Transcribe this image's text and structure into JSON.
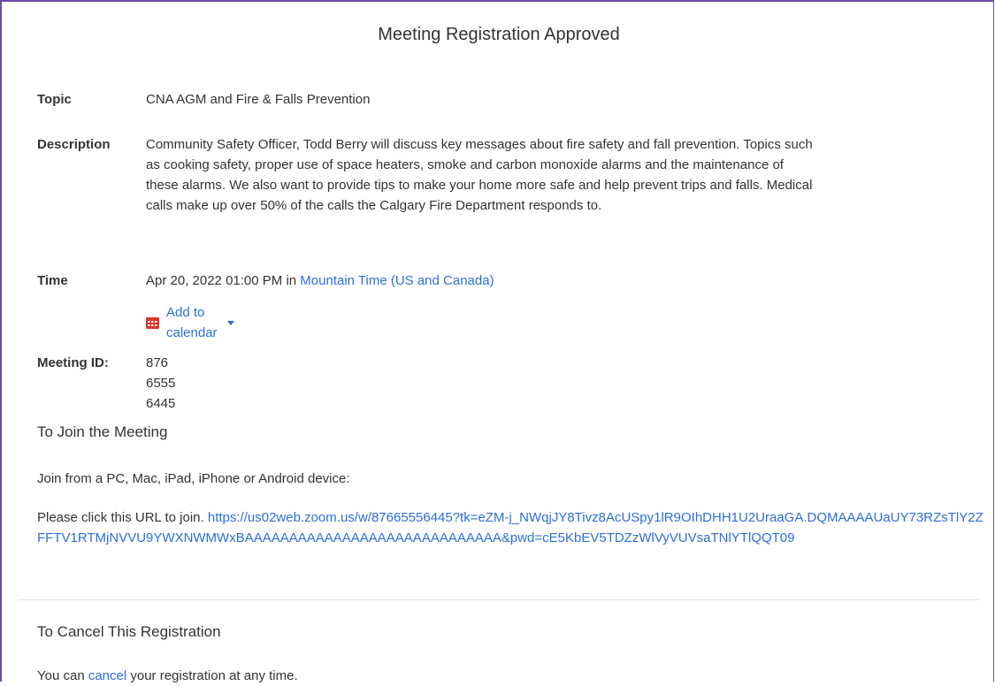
{
  "page_title": "Meeting Registration Approved",
  "topic": {
    "label": "Topic",
    "value": "CNA AGM and Fire & Falls Prevention"
  },
  "description": {
    "label": "Description",
    "value": "Community Safety Officer, Todd Berry will discuss key messages about fire safety and fall prevention. Topics such as cooking safety, proper use of space heaters, smoke and carbon monoxide alarms and the maintenance of these alarms.  We also want to provide tips to make your home more safe and help prevent trips and falls. Medical calls make up over 50% of the calls the Calgary Fire Department responds to."
  },
  "time": {
    "label": "Time",
    "date_text": "Apr 20, 2022 01:00 PM in",
    "timezone_link": "Mountain Time (US and Canada)",
    "add_calendar": "Add to calendar",
    "calendar_icon": "calendar-icon",
    "calendar_icon_color": "#d9342b"
  },
  "meeting_id": {
    "label": "Meeting ID:",
    "value": "876 6555 6445"
  },
  "join": {
    "heading": "To Join the Meeting",
    "devices_text": "Join from a PC, Mac, iPad, iPhone or Android device:",
    "click_text": "Please click this URL to join.",
    "url": "https://us02web.zoom.us/w/87665556445?tk=eZM-j_NWqjJY8Tivz8AcUSpy1lR9OIhDHH1U2UraaGA.DQMAAAAUaUY73RZsTlY2ZFFTV1RTMjNVVU9YWXNWMWxBAAAAAAAAAAAAAAAAAAAAAAAAAAAAA&pwd=cE5KbEV5TDZzWlVyVUVsaTNlYTlQQT09"
  },
  "cancel": {
    "heading": "To Cancel This Registration",
    "text_before": "You can",
    "link": "cancel",
    "text_after": "your registration at any time."
  },
  "colors": {
    "link": "#2d6fdb",
    "frame": "#6c4aa8",
    "text": "#333333"
  }
}
